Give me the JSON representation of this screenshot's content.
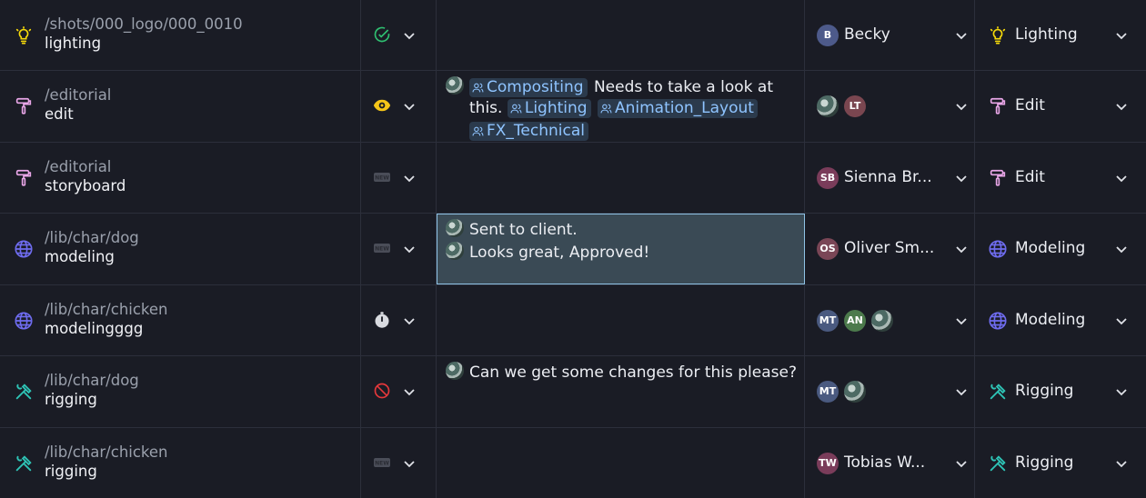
{
  "rows": [
    {
      "path": "/shots/000_logo/000_0010",
      "name": "lighting",
      "task_icon": "lightbulb-icon",
      "status_icon": "check-circle-icon",
      "assignees": [
        {
          "initials": "B",
          "color": "#4d5a8a"
        }
      ],
      "assign_name": "Becky",
      "dept_icon": "lightbulb-icon",
      "dept": "Lighting"
    },
    {
      "path": "/editorial",
      "name": "edit",
      "task_icon": "paint-roller-icon",
      "status_icon": "eye-icon",
      "note": {
        "tags": [
          "Compositing",
          "Lighting",
          "Animation_Layout",
          "FX_Technical"
        ],
        "text1": "Needs to take a look at",
        "text2": "this."
      },
      "assignees": [
        {
          "initials": "",
          "photo": true
        },
        {
          "initials": "LT",
          "color": "#7a4650"
        }
      ],
      "assign_name": "",
      "dept_icon": "paint-roller-icon",
      "dept": "Edit"
    },
    {
      "path": "/editorial",
      "name": "storyboard",
      "task_icon": "paint-roller-icon",
      "status_icon": "new-badge-icon",
      "assignees": [
        {
          "initials": "SB",
          "color": "#7a3c5a"
        }
      ],
      "assign_name": "Sienna Br...",
      "dept_icon": "paint-roller-icon",
      "dept": "Edit"
    },
    {
      "path": "/lib/char/dog",
      "name": "modeling",
      "task_icon": "globe-icon",
      "status_icon": "new-badge-icon",
      "notes": [
        "Sent to client.",
        "Looks great, Approved!"
      ],
      "assignees": [
        {
          "initials": "OS",
          "color": "#7a4656"
        }
      ],
      "assign_name": "Oliver Sm...",
      "dept_icon": "globe-icon",
      "dept": "Modeling"
    },
    {
      "path": "/lib/char/chicken",
      "name": "modelingggg",
      "task_icon": "globe-icon",
      "status_icon": "stopwatch-icon",
      "assignees": [
        {
          "initials": "MT",
          "color": "#4a5a80"
        },
        {
          "initials": "AN",
          "color": "#4c7a4c"
        },
        {
          "initials": "",
          "photo": true
        }
      ],
      "assign_name": "",
      "dept_icon": "globe-icon",
      "dept": "Modeling"
    },
    {
      "path": "/lib/char/dog",
      "name": "rigging",
      "task_icon": "tools-icon",
      "status_icon": "blocked-icon",
      "notes": [
        "Can we get some changes for this please?"
      ],
      "assignees": [
        {
          "initials": "MT",
          "color": "#4a5a80"
        },
        {
          "initials": "",
          "photo": true
        }
      ],
      "assign_name": "",
      "dept_icon": "tools-icon",
      "dept": "Rigging"
    },
    {
      "path": "/lib/char/chicken",
      "name": "rigging",
      "task_icon": "tools-icon",
      "status_icon": "new-badge-icon",
      "assignees": [
        {
          "initials": "TW",
          "color": "#7a3c5a"
        }
      ],
      "assign_name": "Tobias W...",
      "dept_icon": "tools-icon",
      "dept": "Rigging"
    }
  ]
}
